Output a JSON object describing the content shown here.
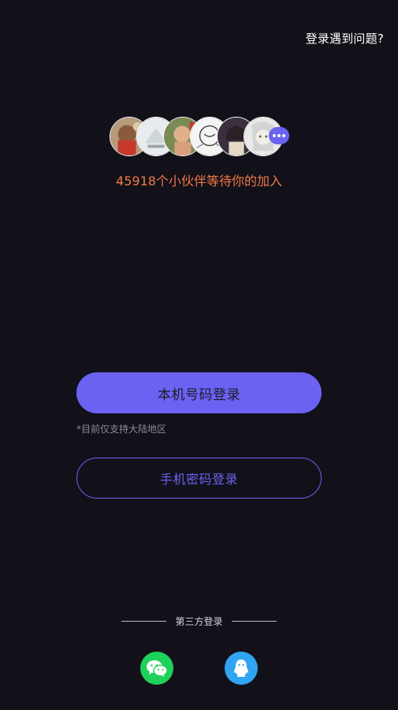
{
  "header": {
    "help_label": "登录遇到问题?"
  },
  "community": {
    "avatars": [
      "avatar-1",
      "avatar-2",
      "avatar-3",
      "avatar-4",
      "avatar-5",
      "avatar-6"
    ],
    "more_icon": "more-dots-icon",
    "join_text": "45918个小伙伴等待你的加入"
  },
  "login": {
    "primary_label": "本机号码登录",
    "note": "*目前仅支持大陆地区",
    "secondary_label": "手机密码登录"
  },
  "third_party": {
    "label": "第三方登录",
    "options": [
      {
        "name": "wechat",
        "icon": "wechat-icon",
        "color": "#1dd15b"
      },
      {
        "name": "qq",
        "icon": "qq-icon",
        "color": "#31a4f2"
      }
    ]
  },
  "colors": {
    "background": "#121119",
    "accent": "#6b62f2",
    "highlight": "#f27a46"
  }
}
